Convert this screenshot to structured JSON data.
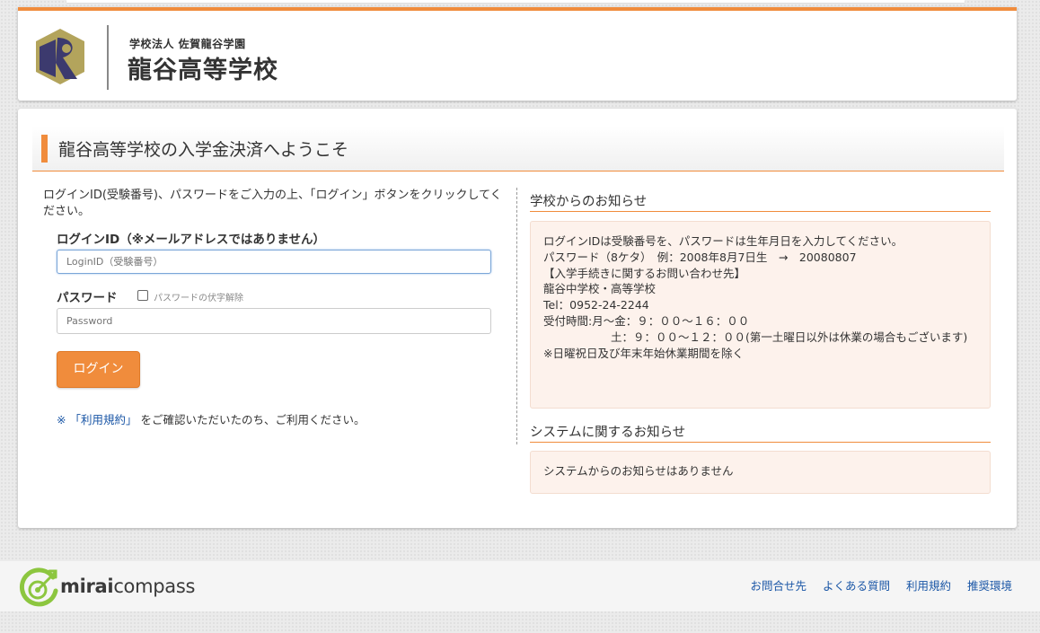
{
  "header": {
    "school_corp": "学校法人 佐賀龍谷学園",
    "school_name": "龍谷高等学校",
    "logo_colors": [
      "#3c3a6e",
      "#b3a45c"
    ]
  },
  "welcome": {
    "title": "龍谷高等学校の入学金決済へようこそ"
  },
  "login": {
    "intro": "ログインID(受験番号)、パスワードをご入力の上、「ログイン」ボタンをクリックしてください。",
    "id_label": "ログインID（※メールアドレスではありません）",
    "id_placeholder": "LoginID（受験番号）",
    "password_label": "パスワード",
    "show_password_label": "パスワードの伏字解除",
    "password_placeholder": "Password",
    "login_button": "ログイン",
    "terms_mark": "※",
    "terms_link": "「利用規約」",
    "terms_suffix": "をご確認いただいたのち、ご利用ください。"
  },
  "school_notices": {
    "title": "学校からのお知らせ",
    "lines": [
      "ログインIDは受験番号を、パスワードは生年月日を入力してください。",
      "パスワード（8ケタ）　例：2008年8月7日生　→　20080807",
      "",
      "【入学手続きに関するお問い合わせ先】",
      "龍谷中学校・高等学校",
      "Tel：0952-24-2244",
      "受付時間:月～金：９：００～１６：００"
    ],
    "saturday_line": "　　　　　　土：９：００～１２：００(第一土曜日以外は休業の場合もございます)",
    "closing_line": "※日曜祝日及び年末年始休業期間を除く"
  },
  "system_notices": {
    "title": "システムに関するお知らせ",
    "message": "システムからのお知らせはありません"
  },
  "footer": {
    "brand_bold": "mirai",
    "brand_rest": "compass",
    "links": [
      "お問合せ先",
      "よくある質問",
      "利用規約",
      "推奨環境"
    ]
  },
  "colors": {
    "accent": "#f08c3c",
    "link": "#1a56a6",
    "notice_bg": "#fdf2ec",
    "brand_green": "#8cc63f"
  }
}
